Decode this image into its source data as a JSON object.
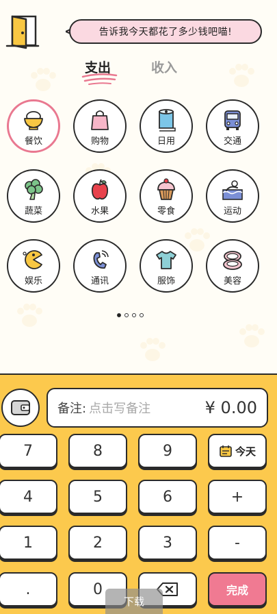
{
  "header": {
    "bubble_text": "告诉我今天都花了多少钱吧喵!"
  },
  "tabs": [
    {
      "label": "支出",
      "active": true
    },
    {
      "label": "收入",
      "active": false
    }
  ],
  "categories": [
    {
      "label": "餐饮",
      "icon": "rice-bowl-icon",
      "selected": true
    },
    {
      "label": "购物",
      "icon": "shopping-bag-icon",
      "selected": false
    },
    {
      "label": "日用",
      "icon": "toilet-paper-icon",
      "selected": false
    },
    {
      "label": "交通",
      "icon": "bus-icon",
      "selected": false
    },
    {
      "label": "蔬菜",
      "icon": "broccoli-icon",
      "selected": false
    },
    {
      "label": "水果",
      "icon": "apple-icon",
      "selected": false
    },
    {
      "label": "零食",
      "icon": "cupcake-icon",
      "selected": false
    },
    {
      "label": "运动",
      "icon": "swimming-icon",
      "selected": false
    },
    {
      "label": "娱乐",
      "icon": "pacman-icon",
      "selected": false
    },
    {
      "label": "通讯",
      "icon": "phone-icon",
      "selected": false
    },
    {
      "label": "服饰",
      "icon": "tshirt-icon",
      "selected": false
    },
    {
      "label": "美容",
      "icon": "compact-mirror-icon",
      "selected": false
    }
  ],
  "pager": {
    "pages": 4,
    "current": 1
  },
  "input": {
    "note_label": "备注:",
    "note_placeholder": "点击写备注",
    "amount": "¥ 0.00"
  },
  "keys": {
    "k7": "7",
    "k8": "8",
    "k9": "9",
    "today": "今天",
    "k4": "4",
    "k5": "5",
    "k6": "6",
    "plus": "+",
    "k1": "1",
    "k2": "2",
    "k3": "3",
    "minus": "-",
    "dot": ".",
    "k0": "0",
    "done": "完成"
  },
  "download_tip": "下载",
  "colors": {
    "accent_pink": "#e97890",
    "keypad_yellow": "#fcc94d",
    "done_button": "#f07a92",
    "bubble_pink": "#fbd9e1"
  }
}
